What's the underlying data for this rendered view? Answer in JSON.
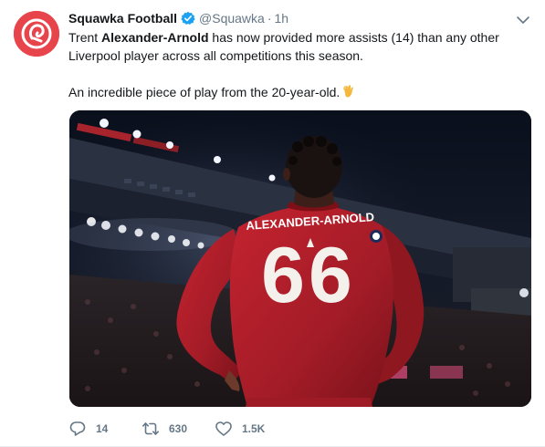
{
  "tweet": {
    "display_name": "Squawka Football",
    "handle": "@Squawka",
    "separator": "·",
    "time": "1h",
    "text_line1_pre": "Trent ",
    "text_line1_bold": "Alexander-Arnold",
    "text_line1_post": " has now provided more assists (14) than any other Liverpool player across all competitions this season.",
    "text_line2": "An incredible piece of play from the 20-year-old.",
    "emoji_icon": "ok-hand-icon",
    "image_jersey_name": "ALEXANDER-ARNOLD",
    "image_jersey_number": "66"
  },
  "actions": {
    "reply_count": "14",
    "retweet_count": "630",
    "like_count": "1.5K"
  },
  "colors": {
    "brand_red": "#e8444b",
    "verified_blue": "#1da1f2",
    "muted": "#657786",
    "text": "#14171a",
    "jersey_red": "#b0202a"
  }
}
